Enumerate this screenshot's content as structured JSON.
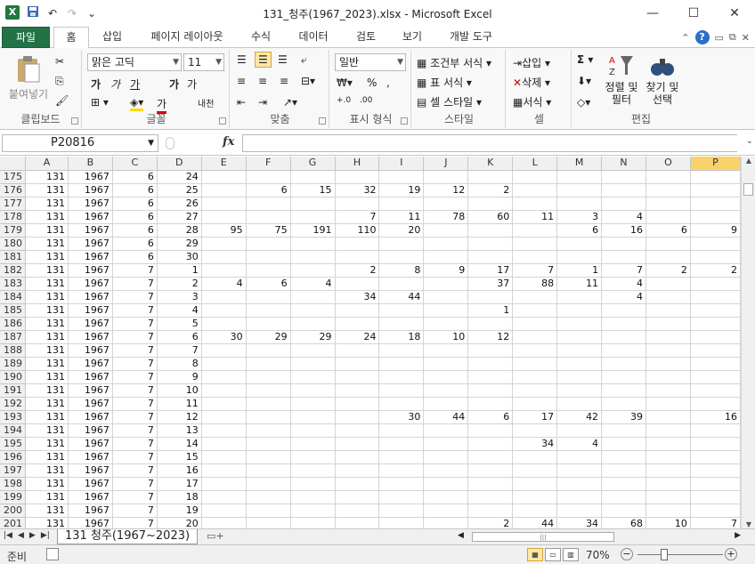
{
  "window": {
    "title": "131_청주(1967_2023).xlsx  -  Microsoft Excel",
    "app_icon_letter": "X",
    "controls": [
      "—",
      "☐",
      "✕"
    ]
  },
  "quick_access": [
    "save-icon",
    "undo-icon",
    "redo-icon",
    "customize-icon"
  ],
  "ribbon_tabs": [
    "파일",
    "홈",
    "삽입",
    "페이지 레이아웃",
    "수식",
    "데이터",
    "검토",
    "보기",
    "개발 도구"
  ],
  "active_tab": "홈",
  "ribbon": {
    "clipboard": {
      "label": "클립보드",
      "paste": "붙여넣기"
    },
    "font": {
      "label": "글꼴",
      "font_name": "맑은 고딕",
      "font_size": "11",
      "bold": "가",
      "italic": "가",
      "underline": "가",
      "grow": "가",
      "shrink": "가",
      "phonetic": "내천"
    },
    "alignment": {
      "label": "맞춤"
    },
    "number": {
      "label": "표시 형식",
      "format": "일반",
      "percent": "%"
    },
    "styles": {
      "label": "스타일",
      "conditional": "조건부 서식",
      "table": "표 서식",
      "cell": "셀 스타일"
    },
    "cells": {
      "label": "셀",
      "insert": "삽입",
      "delete": "삭제",
      "format": "서식"
    },
    "editing": {
      "label": "편집",
      "sort": "정렬 및 필터",
      "find": "찾기 및 선택",
      "sigma": "Σ"
    }
  },
  "formula_bar": {
    "name_box": "P20816",
    "fx": "fx",
    "value": ""
  },
  "columns": [
    "A",
    "B",
    "C",
    "D",
    "E",
    "F",
    "G",
    "H",
    "I",
    "J",
    "K",
    "L",
    "M",
    "N",
    "O",
    "P"
  ],
  "selected_column": "P",
  "rows": [
    {
      "n": "175",
      "cells": [
        "131",
        "1967",
        "6",
        "24",
        "",
        "",
        "",
        "",
        "",
        "",
        "",
        "",
        "",
        "",
        "",
        ""
      ]
    },
    {
      "n": "176",
      "cells": [
        "131",
        "1967",
        "6",
        "25",
        "",
        "6",
        "15",
        "32",
        "19",
        "12",
        "2",
        "",
        "",
        "",
        "",
        ""
      ]
    },
    {
      "n": "177",
      "cells": [
        "131",
        "1967",
        "6",
        "26",
        "",
        "",
        "",
        "",
        "",
        "",
        "",
        "",
        "",
        "",
        "",
        ""
      ]
    },
    {
      "n": "178",
      "cells": [
        "131",
        "1967",
        "6",
        "27",
        "",
        "",
        "",
        "7",
        "11",
        "78",
        "60",
        "11",
        "3",
        "4",
        "",
        ""
      ]
    },
    {
      "n": "179",
      "cells": [
        "131",
        "1967",
        "6",
        "28",
        "95",
        "75",
        "191",
        "110",
        "20",
        "",
        "",
        "",
        "6",
        "16",
        "6",
        "9"
      ]
    },
    {
      "n": "180",
      "cells": [
        "131",
        "1967",
        "6",
        "29",
        "",
        "",
        "",
        "",
        "",
        "",
        "",
        "",
        "",
        "",
        "",
        ""
      ]
    },
    {
      "n": "181",
      "cells": [
        "131",
        "1967",
        "6",
        "30",
        "",
        "",
        "",
        "",
        "",
        "",
        "",
        "",
        "",
        "",
        "",
        ""
      ]
    },
    {
      "n": "182",
      "cells": [
        "131",
        "1967",
        "7",
        "1",
        "",
        "",
        "",
        "2",
        "8",
        "9",
        "17",
        "7",
        "1",
        "7",
        "2",
        "2"
      ]
    },
    {
      "n": "183",
      "cells": [
        "131",
        "1967",
        "7",
        "2",
        "4",
        "6",
        "4",
        "",
        "",
        "",
        "37",
        "88",
        "11",
        "4",
        "",
        ""
      ]
    },
    {
      "n": "184",
      "cells": [
        "131",
        "1967",
        "7",
        "3",
        "",
        "",
        "",
        "34",
        "44",
        "",
        "",
        "",
        "",
        "4",
        "",
        ""
      ]
    },
    {
      "n": "185",
      "cells": [
        "131",
        "1967",
        "7",
        "4",
        "",
        "",
        "",
        "",
        "",
        "",
        "1",
        "",
        "",
        "",
        "",
        ""
      ]
    },
    {
      "n": "186",
      "cells": [
        "131",
        "1967",
        "7",
        "5",
        "",
        "",
        "",
        "",
        "",
        "",
        "",
        "",
        "",
        "",
        "",
        ""
      ]
    },
    {
      "n": "187",
      "cells": [
        "131",
        "1967",
        "7",
        "6",
        "30",
        "29",
        "29",
        "24",
        "18",
        "10",
        "12",
        "",
        "",
        "",
        "",
        ""
      ]
    },
    {
      "n": "188",
      "cells": [
        "131",
        "1967",
        "7",
        "7",
        "",
        "",
        "",
        "",
        "",
        "",
        "",
        "",
        "",
        "",
        "",
        ""
      ]
    },
    {
      "n": "189",
      "cells": [
        "131",
        "1967",
        "7",
        "8",
        "",
        "",
        "",
        "",
        "",
        "",
        "",
        "",
        "",
        "",
        "",
        ""
      ]
    },
    {
      "n": "190",
      "cells": [
        "131",
        "1967",
        "7",
        "9",
        "",
        "",
        "",
        "",
        "",
        "",
        "",
        "",
        "",
        "",
        "",
        ""
      ]
    },
    {
      "n": "191",
      "cells": [
        "131",
        "1967",
        "7",
        "10",
        "",
        "",
        "",
        "",
        "",
        "",
        "",
        "",
        "",
        "",
        "",
        ""
      ]
    },
    {
      "n": "192",
      "cells": [
        "131",
        "1967",
        "7",
        "11",
        "",
        "",
        "",
        "",
        "",
        "",
        "",
        "",
        "",
        "",
        "",
        ""
      ]
    },
    {
      "n": "193",
      "cells": [
        "131",
        "1967",
        "7",
        "12",
        "",
        "",
        "",
        "",
        "30",
        "44",
        "6",
        "17",
        "42",
        "39",
        "",
        "16"
      ]
    },
    {
      "n": "194",
      "cells": [
        "131",
        "1967",
        "7",
        "13",
        "",
        "",
        "",
        "",
        "",
        "",
        "",
        "",
        "",
        "",
        "",
        ""
      ]
    },
    {
      "n": "195",
      "cells": [
        "131",
        "1967",
        "7",
        "14",
        "",
        "",
        "",
        "",
        "",
        "",
        "",
        "34",
        "4",
        "",
        "",
        ""
      ]
    },
    {
      "n": "196",
      "cells": [
        "131",
        "1967",
        "7",
        "15",
        "",
        "",
        "",
        "",
        "",
        "",
        "",
        "",
        "",
        "",
        "",
        ""
      ]
    },
    {
      "n": "197",
      "cells": [
        "131",
        "1967",
        "7",
        "16",
        "",
        "",
        "",
        "",
        "",
        "",
        "",
        "",
        "",
        "",
        "",
        ""
      ]
    },
    {
      "n": "198",
      "cells": [
        "131",
        "1967",
        "7",
        "17",
        "",
        "",
        "",
        "",
        "",
        "",
        "",
        "",
        "",
        "",
        "",
        ""
      ]
    },
    {
      "n": "199",
      "cells": [
        "131",
        "1967",
        "7",
        "18",
        "",
        "",
        "",
        "",
        "",
        "",
        "",
        "",
        "",
        "",
        "",
        ""
      ]
    },
    {
      "n": "200",
      "cells": [
        "131",
        "1967",
        "7",
        "19",
        "",
        "",
        "",
        "",
        "",
        "",
        "",
        "",
        "",
        "",
        "",
        ""
      ]
    },
    {
      "n": "201",
      "cells": [
        "131",
        "1967",
        "7",
        "20",
        "",
        "",
        "",
        "",
        "",
        "",
        "2",
        "44",
        "34",
        "68",
        "10",
        "7"
      ]
    }
  ],
  "sheet_tab": "131 청주(1967~2023)",
  "status": {
    "ready": "준비",
    "zoom": "70%",
    "zoom_level_percent": 70
  },
  "colors": {
    "excel_green": "#217346",
    "selected_header": "#f9d26a"
  }
}
